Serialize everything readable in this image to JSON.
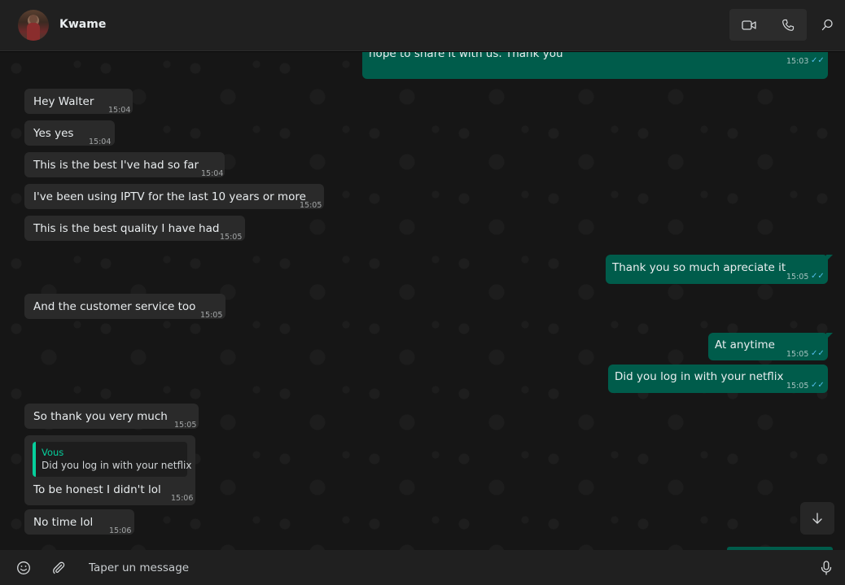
{
  "header": {
    "contact_name": "Kwame"
  },
  "messages": [
    {
      "dir": "out",
      "text": "hope to share it with us. Thank you",
      "time": "15:03",
      "ticks": "✓✓"
    },
    {
      "dir": "in",
      "text": "Hey Walter",
      "time": "15:04"
    },
    {
      "dir": "in",
      "text": "Yes yes",
      "time": "15:04"
    },
    {
      "dir": "in",
      "text": "This is the best I've had so far",
      "time": "15:04"
    },
    {
      "dir": "in",
      "text": "I've been using IPTV for the last 10 years or more",
      "time": "15:05"
    },
    {
      "dir": "in",
      "text": "This is the best quality I have had",
      "time": "15:05"
    },
    {
      "dir": "out",
      "text": "Thank you so much apreciate it",
      "time": "15:05",
      "ticks": "✓✓"
    },
    {
      "dir": "in",
      "text": "And the customer service too",
      "time": "15:05"
    },
    {
      "dir": "out",
      "text": "At anytime",
      "time": "15:05",
      "ticks": "✓✓"
    },
    {
      "dir": "out",
      "text": "Did you log in with your netflix",
      "time": "15:05",
      "ticks": "✓✓"
    },
    {
      "dir": "in",
      "text": "So thank you very much",
      "time": "15:05"
    },
    {
      "dir": "in",
      "text": "To be honest I didn't lol",
      "time": "15:06",
      "quote": {
        "author": "Vous",
        "text": "Did you log in with your netflix"
      }
    },
    {
      "dir": "in",
      "text": "No time lol",
      "time": "15:06"
    }
  ],
  "composer": {
    "placeholder": "Taper un message"
  },
  "icons": {
    "video_call": "video-camera-icon",
    "voice_call": "phone-icon",
    "search": "search-icon",
    "emoji": "emoji-icon",
    "attach": "paperclip-icon",
    "mic": "microphone-icon",
    "scroll_down": "arrow-down-icon"
  },
  "colors": {
    "incoming_bubble": "#2a2a2a",
    "outgoing_bubble": "#005c4b",
    "read_ticks": "#53bdeb",
    "quote_accent": "#06cf9c"
  }
}
